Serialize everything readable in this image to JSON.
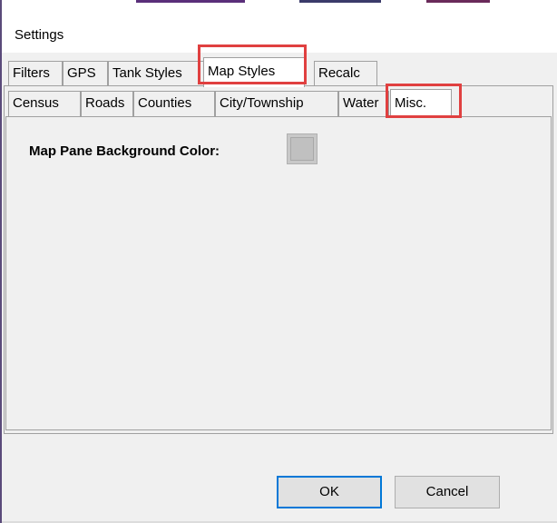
{
  "window": {
    "title": "Settings"
  },
  "main_tabs": [
    {
      "label": "Filters",
      "selected": false
    },
    {
      "label": "GPS",
      "selected": false
    },
    {
      "label": "Tank Styles",
      "selected": false
    },
    {
      "label": "Map Styles",
      "selected": true
    },
    {
      "label": "Recalc",
      "selected": false
    }
  ],
  "sub_tabs": [
    {
      "label": "Census",
      "selected": false
    },
    {
      "label": "Roads",
      "selected": false
    },
    {
      "label": "Counties",
      "selected": false
    },
    {
      "label": "City/Township",
      "selected": false
    },
    {
      "label": "Water",
      "selected": false
    },
    {
      "label": "Misc.",
      "selected": true
    }
  ],
  "misc": {
    "background_color_label": "Map Pane Background Color:",
    "background_color_value": "#c0c0c0"
  },
  "buttons": {
    "ok_label": "OK",
    "cancel_label": "Cancel"
  },
  "colors": {
    "highlight": "#e04040",
    "focus_border": "#0078d7",
    "window_bg": "#f0f0f0"
  }
}
